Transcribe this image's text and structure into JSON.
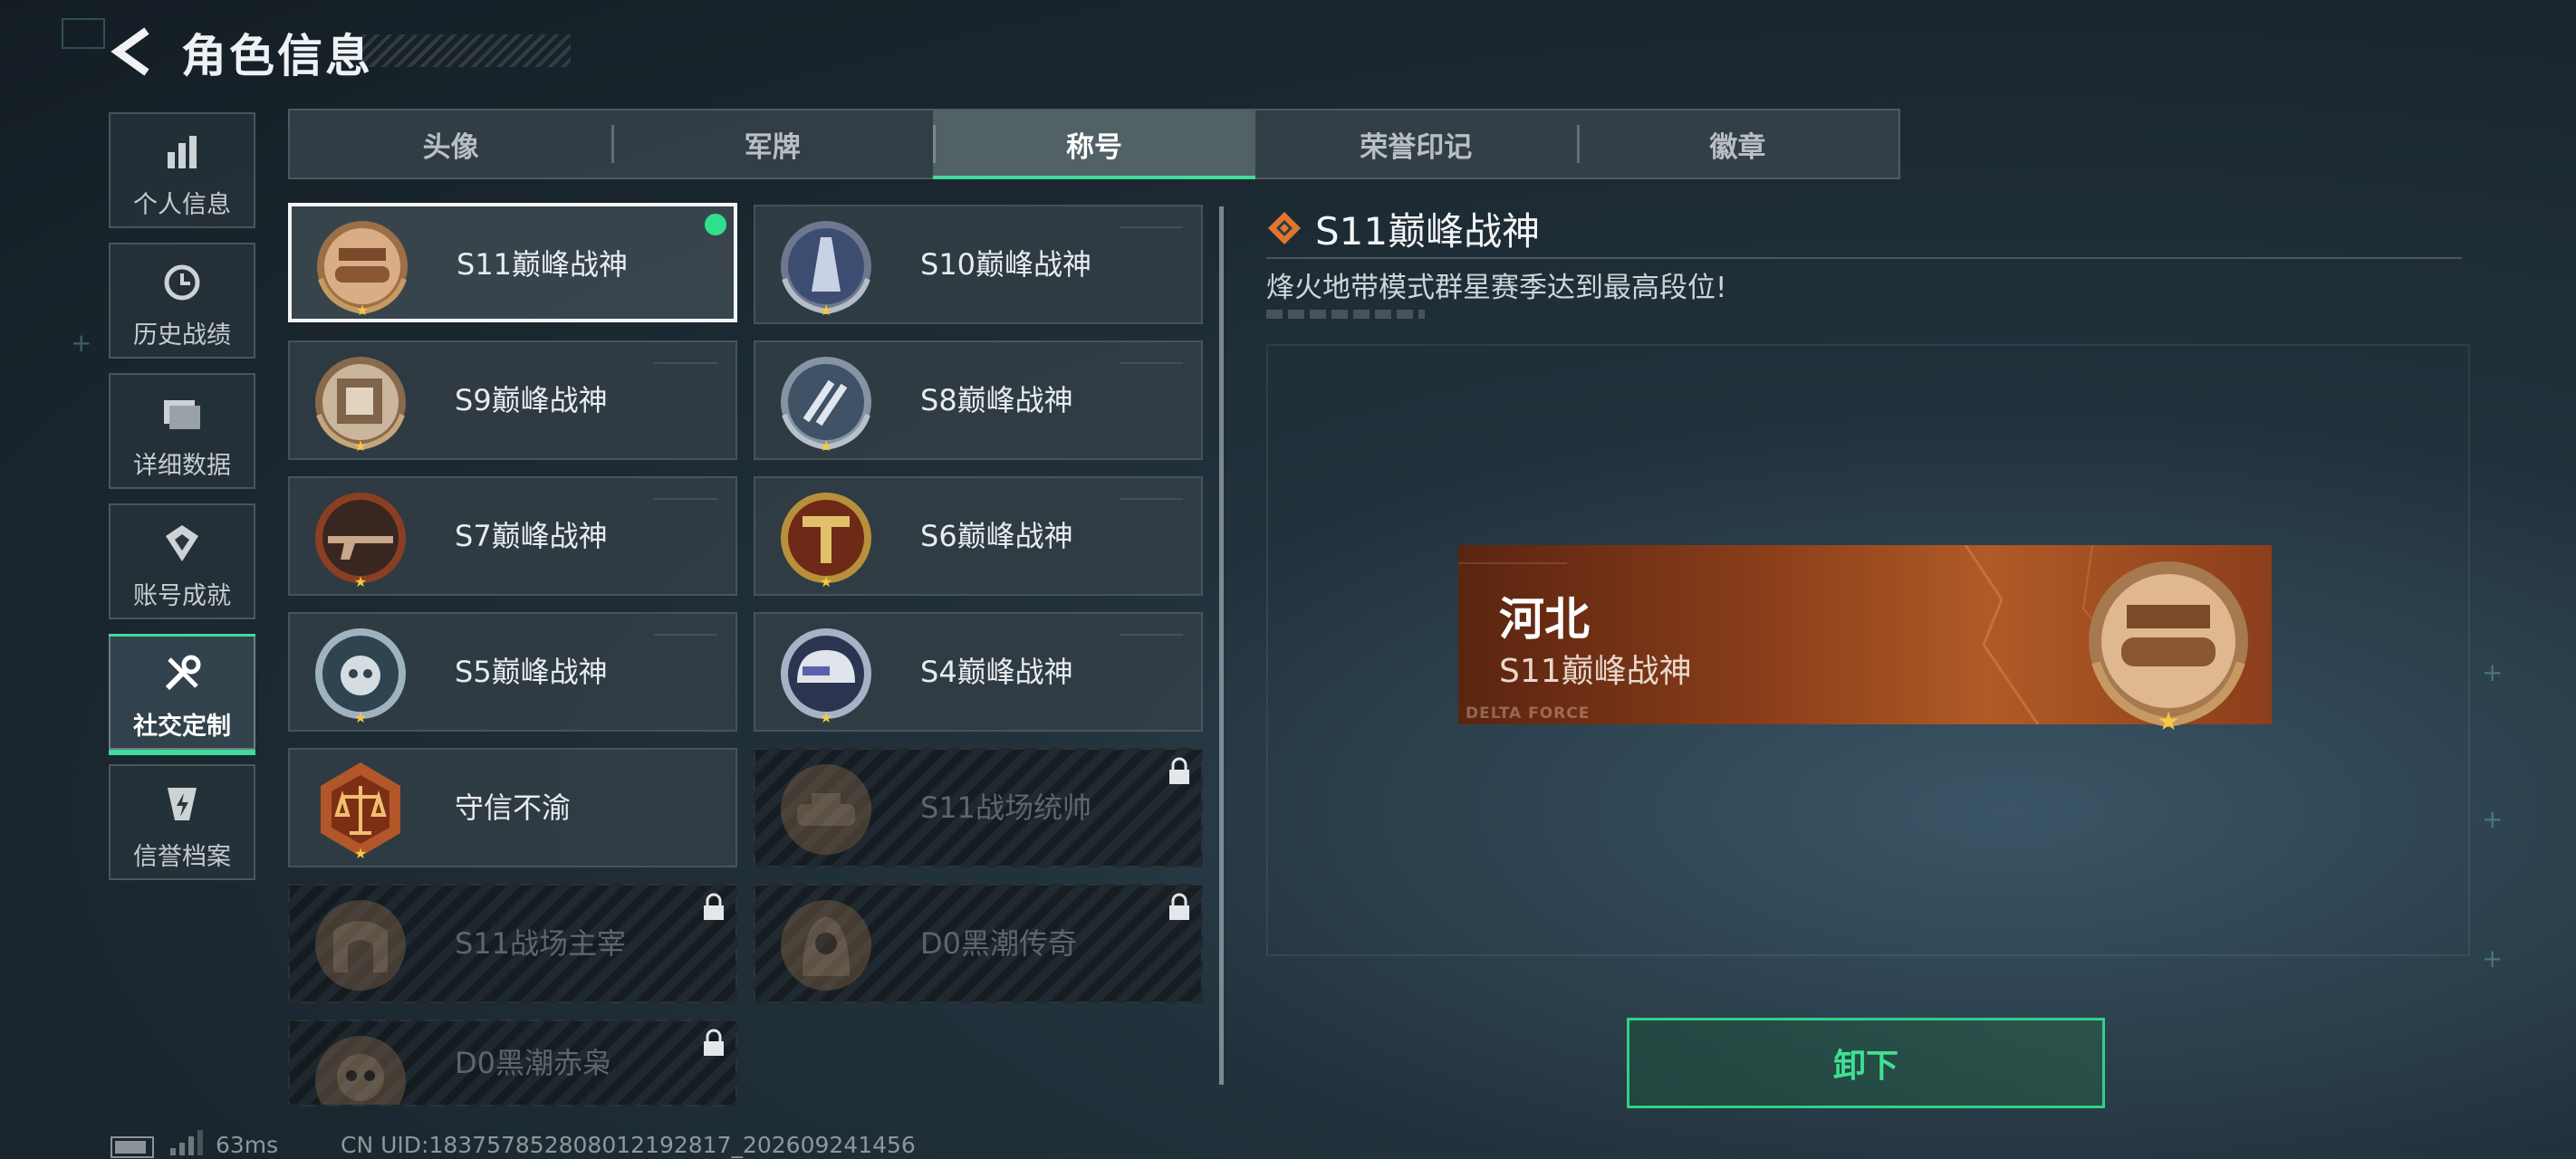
{
  "header": {
    "title": "角色信息",
    "back_icon": "back-arrow-icon"
  },
  "sidebar": {
    "items": [
      {
        "label": "个人信息",
        "icon": "bar-chart-icon",
        "active": false
      },
      {
        "label": "历史战绩",
        "icon": "clock-history-icon",
        "active": false
      },
      {
        "label": "详细数据",
        "icon": "folder-icon",
        "active": false
      },
      {
        "label": "账号成就",
        "icon": "achievement-icon",
        "active": false
      },
      {
        "label": "社交定制",
        "icon": "tools-icon",
        "active": true
      },
      {
        "label": "信誉档案",
        "icon": "shield-lightning-icon",
        "active": false
      }
    ]
  },
  "tabs": [
    {
      "label": "头像",
      "active": false
    },
    {
      "label": "军牌",
      "active": false
    },
    {
      "label": "称号",
      "active": true
    },
    {
      "label": "荣誉印记",
      "active": false
    },
    {
      "label": "徽章",
      "active": false
    }
  ],
  "titles": [
    {
      "name": "S11巅峰战神",
      "locked": false,
      "selected": true,
      "equipped": true
    },
    {
      "name": "S10巅峰战神",
      "locked": false
    },
    {
      "name": "S9巅峰战神",
      "locked": false
    },
    {
      "name": "S8巅峰战神",
      "locked": false
    },
    {
      "name": "S7巅峰战神",
      "locked": false
    },
    {
      "name": "S6巅峰战神",
      "locked": false
    },
    {
      "name": "S5巅峰战神",
      "locked": false
    },
    {
      "name": "S4巅峰战神",
      "locked": false
    },
    {
      "name": "守信不渝",
      "locked": false
    },
    {
      "name": "S11战场统帅",
      "locked": true
    },
    {
      "name": "S11战场主宰",
      "locked": true
    },
    {
      "name": "D0黑潮传奇",
      "locked": true
    },
    {
      "name": "D0黑潮赤枭",
      "locked": true
    }
  ],
  "detail": {
    "title": "S11巅峰战神",
    "description": "烽火地带模式群星赛季达到最高段位!",
    "banner": {
      "region": "河北",
      "title": "S11巅峰战神",
      "brand": "DELTA FORCE"
    },
    "unequip_label": "卸下"
  },
  "footer": {
    "ping": "63ms",
    "uid": "CN UID:18375785280801219281‌7_202609241456"
  },
  "colors": {
    "accent": "#3fdc9a",
    "banner": "#a4521f",
    "bronze": "#b98a5c"
  }
}
